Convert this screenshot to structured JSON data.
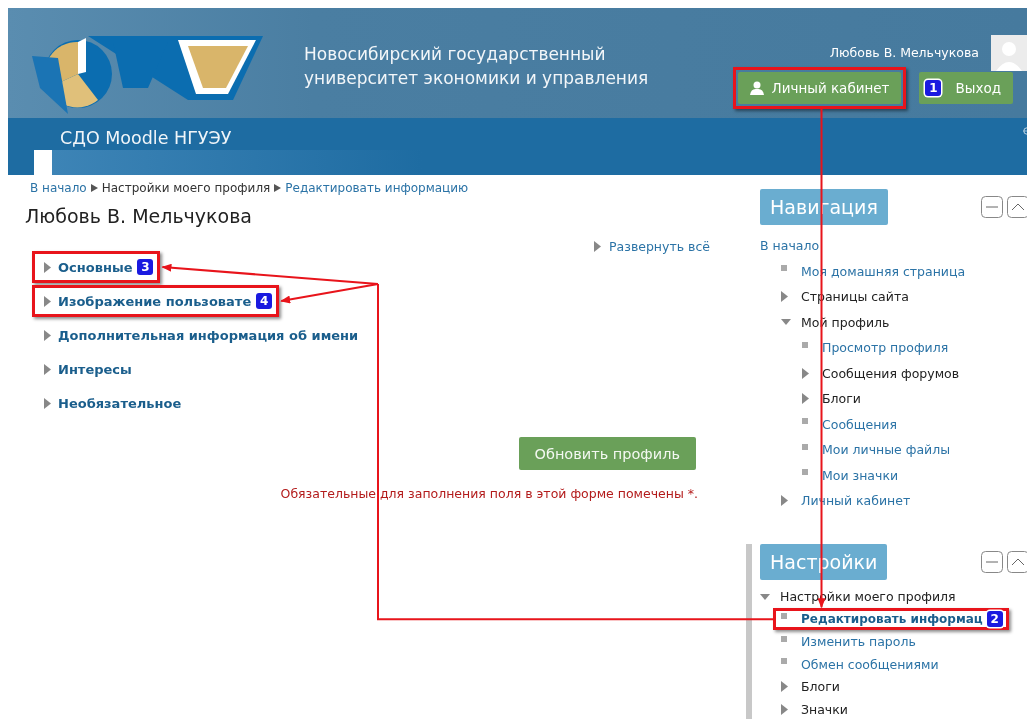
{
  "header": {
    "university_lines": [
      "Новосибирский государственный",
      "университет экономики и управления"
    ],
    "user_name": "Любовь В. Мельчукова",
    "buttons": [
      {
        "label": "Личный кабинет",
        "kind": "account"
      },
      {
        "label": "Выход",
        "kind": "logout"
      }
    ]
  },
  "navbar": {
    "site_name": "СДО Moodle НГУЭУ"
  },
  "breadcrumb": [
    {
      "label": "В начало",
      "link": true
    },
    {
      "label": "Настройки моего профиля",
      "link": false
    },
    {
      "label": "Редактировать информацию",
      "link": true
    }
  ],
  "page_title": "Любовь В. Мельчукова",
  "expand_all": "Развернуть всё",
  "form_sections": [
    {
      "label": "Основные",
      "expanded": false
    },
    {
      "label": "Изображение пользовате",
      "expanded": false
    },
    {
      "label": "Дополнительная информация об имени",
      "expanded": false
    },
    {
      "label": "Интересы",
      "expanded": false
    },
    {
      "label": "Необязательное",
      "expanded": false
    }
  ],
  "submit_button": "Обновить профиль",
  "required_note": "Обязательные для заполнения поля в этой форме помечены *.",
  "blocks": [
    {
      "title": "Навигация",
      "items": [
        {
          "label": "В начало",
          "kind": "plain",
          "link": true,
          "selected": false,
          "children": [
            {
              "label": "Моя домашняя страница",
              "kind": "leaf",
              "link": true,
              "selected": false
            },
            {
              "label": "Страницы сайта",
              "kind": "branch",
              "link": false,
              "expanded": false,
              "selected": false
            },
            {
              "label": "Мой профиль",
              "kind": "branch",
              "link": false,
              "expanded": true,
              "selected": false,
              "children": [
                {
                  "label": "Просмотр профиля",
                  "kind": "leaf",
                  "link": true,
                  "selected": false
                },
                {
                  "label": "Сообщения форумов",
                  "kind": "branch",
                  "link": false,
                  "expanded": false,
                  "selected": false
                },
                {
                  "label": "Блоги",
                  "kind": "branch",
                  "link": false,
                  "expanded": false,
                  "selected": false
                },
                {
                  "label": "Сообщения",
                  "kind": "leaf",
                  "link": true,
                  "selected": false
                },
                {
                  "label": "Мои личные файлы",
                  "kind": "leaf",
                  "link": true,
                  "selected": false
                },
                {
                  "label": "Мои значки",
                  "kind": "leaf",
                  "link": true,
                  "selected": false
                }
              ]
            },
            {
              "label": "Личный кабинет",
              "kind": "branch",
              "link": true,
              "expanded": false,
              "selected": false
            }
          ]
        }
      ]
    },
    {
      "title": "Настройки",
      "items": [
        {
          "label": "Настройки моего профиля",
          "kind": "branch",
          "link": false,
          "expanded": true,
          "selected": false,
          "children": [
            {
              "label": "Редактировать информац",
              "kind": "leaf",
              "link": true,
              "selected": true
            },
            {
              "label": "Изменить пароль",
              "kind": "leaf",
              "link": true,
              "selected": false
            },
            {
              "label": "Обмен сообщениями",
              "kind": "leaf",
              "link": true,
              "selected": false
            },
            {
              "label": "Блоги",
              "kind": "branch",
              "link": false,
              "expanded": false,
              "selected": false
            },
            {
              "label": "Значки",
              "kind": "branch",
              "link": false,
              "expanded": false,
              "selected": false
            }
          ]
        }
      ]
    }
  ],
  "annotations": [
    {
      "badge": "1"
    },
    {
      "badge": "2"
    },
    {
      "badge": "3"
    },
    {
      "badge": "4"
    }
  ]
}
